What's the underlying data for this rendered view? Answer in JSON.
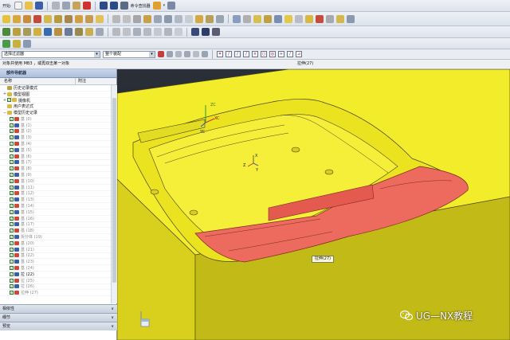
{
  "toolbar": {
    "start_label": "开始·",
    "command_finder_label": "命令查找器"
  },
  "selection_bar": {
    "filter_value": "选择过滤器",
    "scope_value": "整个装配"
  },
  "cue_line": {
    "prompt": "对象并使用 MB3 ，或再双击某一对象",
    "status": "拉伸(27)"
  },
  "navigator": {
    "title": "部件导航器",
    "columns": [
      "名称",
      "附注"
    ],
    "nodes": [
      {
        "label": "历史记录模式",
        "indent": 1,
        "expander": "",
        "icon": "history-icon",
        "checked": false
      },
      {
        "label": "模型视图",
        "indent": 1,
        "expander": "+",
        "icon": "view-folder-icon",
        "checked": false
      },
      {
        "label": "摄像机",
        "indent": 1,
        "expander": "+",
        "icon": "camera-folder-icon",
        "checked": true
      },
      {
        "label": "用户表达式",
        "indent": 1,
        "expander": "",
        "icon": "expression-folder-icon",
        "checked": false
      },
      {
        "label": "模型历史记录",
        "indent": 1,
        "expander": "−",
        "icon": "history-folder-icon",
        "checked": false
      },
      {
        "label": "基 (0)",
        "indent": 2,
        "checked": true
      },
      {
        "label": "基 (1)",
        "indent": 2,
        "checked": true
      },
      {
        "label": "基 (2)",
        "indent": 2,
        "checked": true
      },
      {
        "label": "基 (3)",
        "indent": 2,
        "checked": true
      },
      {
        "label": "基 (4)",
        "indent": 2,
        "checked": true
      },
      {
        "label": "基 (5)",
        "indent": 2,
        "checked": true
      },
      {
        "label": "基 (6)",
        "indent": 2,
        "checked": true
      },
      {
        "label": "基 (7)",
        "indent": 2,
        "checked": true
      },
      {
        "label": "基 (8)",
        "indent": 2,
        "checked": true
      },
      {
        "label": "基 (9)",
        "indent": 2,
        "checked": true
      },
      {
        "label": "基 (10)",
        "indent": 2,
        "checked": true
      },
      {
        "label": "基 (11)",
        "indent": 2,
        "checked": true
      },
      {
        "label": "基 (12)",
        "indent": 2,
        "checked": true
      },
      {
        "label": "基 (13)",
        "indent": 2,
        "checked": true
      },
      {
        "label": "基 (14)",
        "indent": 2,
        "checked": true
      },
      {
        "label": "基 (15)",
        "indent": 2,
        "checked": true
      },
      {
        "label": "基 (16)",
        "indent": 2,
        "checked": true
      },
      {
        "label": "基 (17)",
        "indent": 2,
        "checked": true
      },
      {
        "label": "基 (18)",
        "indent": 2,
        "checked": true
      },
      {
        "label": "拆分体 (19)",
        "indent": 2,
        "checked": true
      },
      {
        "label": "基 (20)",
        "indent": 2,
        "checked": true
      },
      {
        "label": "基 (21)",
        "indent": 2,
        "checked": true
      },
      {
        "label": "基 (22)",
        "indent": 2,
        "checked": true
      },
      {
        "label": "基 (23)",
        "indent": 2,
        "checked": true
      },
      {
        "label": "基 (24)",
        "indent": 2,
        "checked": true
      },
      {
        "label": "拉 (22)",
        "indent": 2,
        "checked": true,
        "dark": true
      },
      {
        "label": "拉 (25)",
        "indent": 2,
        "checked": true
      },
      {
        "label": "拉 (26)",
        "indent": 2,
        "checked": true
      },
      {
        "label": "拉伸 (27)",
        "indent": 2,
        "checked": true
      }
    ],
    "panels": [
      "相依性",
      "细节",
      "预览"
    ]
  },
  "viewport": {
    "feature_tag": "拉伸(27)",
    "axis_labels": {
      "wcs_x": "XC",
      "wcs_y": "YC",
      "wcs_z": "ZC",
      "x": "X",
      "y": "Y",
      "z": "Z"
    },
    "colors": {
      "background": "#1c1f26",
      "mold_yellow": "#f2ec2a",
      "mold_side": "#d8d01c",
      "highlight_red": "#ec6a5e",
      "edge": "#4a4710"
    }
  },
  "watermark": {
    "text": "UG—NX教程"
  }
}
